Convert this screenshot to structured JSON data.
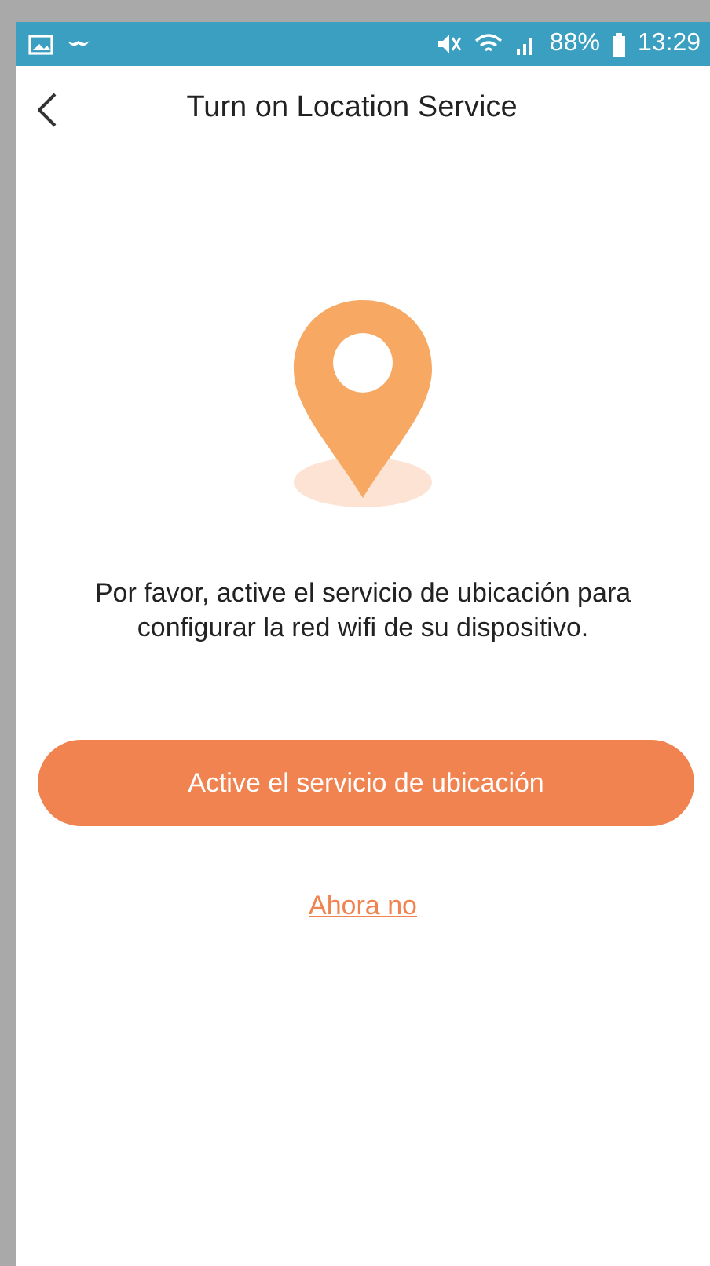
{
  "status_bar": {
    "battery": "88%",
    "time": "13:29"
  },
  "header": {
    "title": "Turn on Location Service"
  },
  "message": "Por favor, active el servicio de ubicación para configurar la red wifi de su dispositivo.",
  "primary_button": "Active el servicio de ubicación",
  "secondary_link": "Ahora no"
}
